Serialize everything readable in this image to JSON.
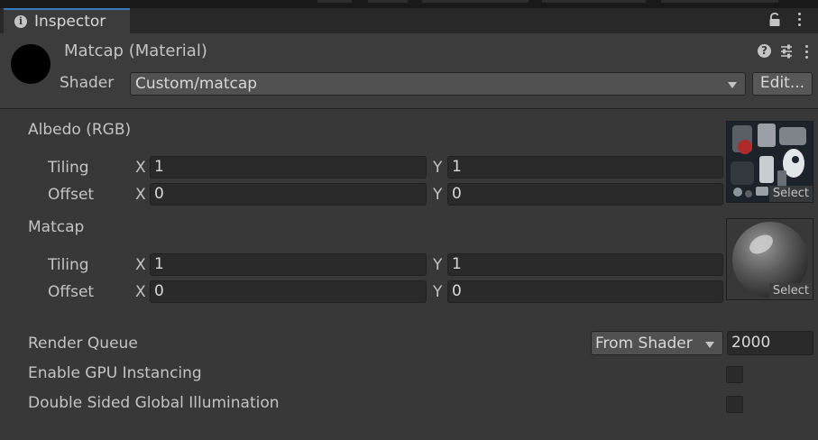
{
  "window": {
    "tab_label": "Inspector",
    "icons": {
      "tab": "info-icon",
      "lock": "lock-icon",
      "menu": "kebab-menu-icon"
    }
  },
  "material": {
    "title": "Matcap (Material)",
    "shader_label": "Shader",
    "shader_value": "Custom/matcap",
    "edit_label": "Edit...",
    "icons": {
      "help": "help-icon",
      "presets": "presets-icon",
      "menu": "kebab-menu-icon"
    }
  },
  "properties": {
    "albedo": {
      "label": "Albedo (RGB)",
      "tiling_label": "Tiling",
      "offset_label": "Offset",
      "x_label": "X",
      "y_label": "Y",
      "tiling_x": "1",
      "tiling_y": "1",
      "offset_x": "0",
      "offset_y": "0",
      "select_label": "Select"
    },
    "matcap": {
      "label": "Matcap",
      "tiling_label": "Tiling",
      "offset_label": "Offset",
      "x_label": "X",
      "y_label": "Y",
      "tiling_x": "1",
      "tiling_y": "1",
      "offset_x": "0",
      "offset_y": "0",
      "select_label": "Select"
    }
  },
  "render_queue": {
    "label": "Render Queue",
    "mode": "From Shader",
    "value": "2000"
  },
  "gpu_instancing": {
    "label": "Enable GPU Instancing",
    "checked": false
  },
  "double_sided_gi": {
    "label": "Double Sided Global Illumination",
    "checked": false
  },
  "colors": {
    "accent": "#3a79bb",
    "background": "#383838",
    "field": "#2a2a2a"
  }
}
